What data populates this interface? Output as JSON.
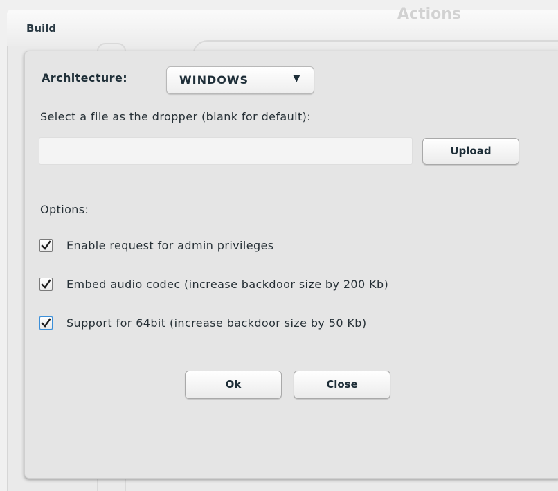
{
  "background": {
    "tab_title": "Build",
    "actions_label": "Actions"
  },
  "dialog": {
    "architecture_label": "Architecture:",
    "architecture_value": "WINDOWS",
    "dropper_label": "Select a file as the dropper (blank for default):",
    "dropper_value": "",
    "dropper_placeholder": "",
    "upload_label": "Upload",
    "options_label": "Options:",
    "options": [
      {
        "label": "Enable request for admin privileges",
        "checked": true
      },
      {
        "label": "Embed audio codec (increase backdoor size by 200 Kb)",
        "checked": true
      },
      {
        "label": "Support for 64bit (increase backdoor size by 50 Kb)",
        "checked": true,
        "focused": true
      }
    ],
    "ok_label": "Ok",
    "close_label": "Close"
  },
  "icons": {
    "dropdown": "caret-down-icon",
    "check": "checkmark-icon"
  },
  "colors": {
    "dialog_bg": "#e5e5e5",
    "text": "#263036",
    "focus": "#3c8fd8"
  }
}
